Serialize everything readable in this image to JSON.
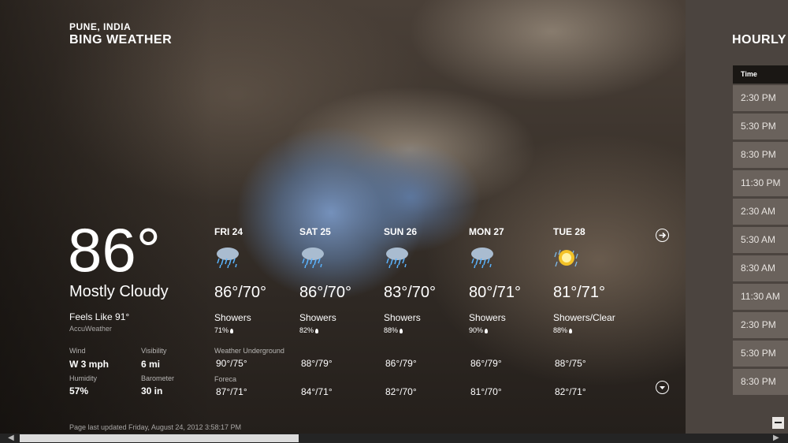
{
  "location": "PUNE, INDIA",
  "app_title": "BING WEATHER",
  "current": {
    "temp": "86°",
    "condition": "Mostly Cloudy",
    "feels_like": "Feels Like 91°",
    "provider": "AccuWeather",
    "stats": [
      {
        "label": "Wind",
        "value": "W 3 mph"
      },
      {
        "label": "Visibility",
        "value": "6 mi"
      },
      {
        "label": "Humidity",
        "value": "57%"
      },
      {
        "label": "Barometer",
        "value": "30 in"
      }
    ]
  },
  "sources": [
    "Weather Underground",
    "Foreca"
  ],
  "forecast": [
    {
      "day": "FRI 24",
      "icon": "showers-icon",
      "hilo": "86°/70°",
      "desc": "Showers",
      "precip": "71%",
      "src1": "90°/75°",
      "src2": "87°/71°"
    },
    {
      "day": "SAT 25",
      "icon": "showers-icon",
      "hilo": "86°/70°",
      "desc": "Showers",
      "precip": "82%",
      "src1": "88°/79°",
      "src2": "84°/71°"
    },
    {
      "day": "SUN 26",
      "icon": "showers-icon",
      "hilo": "83°/70°",
      "desc": "Showers",
      "precip": "88%",
      "src1": "86°/79°",
      "src2": "82°/70°"
    },
    {
      "day": "MON 27",
      "icon": "showers-icon",
      "hilo": "80°/71°",
      "desc": "Showers",
      "precip": "90%",
      "src1": "86°/79°",
      "src2": "81°/70°"
    },
    {
      "day": "TUE 28",
      "icon": "sun-showers-icon",
      "hilo": "81°/71°",
      "desc": "Showers/Clear",
      "precip": "88%",
      "src1": "88°/75°",
      "src2": "82°/71°"
    }
  ],
  "updated": "Page last updated Friday, August 24, 2012 3:58:17 PM",
  "hourly": {
    "title": "HOURLY",
    "header": "Time",
    "times": [
      "2:30 PM",
      "5:30 PM",
      "8:30 PM",
      "11:30 PM",
      "2:30 AM",
      "5:30 AM",
      "8:30 AM",
      "11:30 AM",
      "2:30 PM",
      "5:30 PM",
      "8:30 PM"
    ]
  },
  "colors": {
    "hourly_panel": "#4b443f",
    "time_cell": "#6a625c",
    "header": "#1a1714"
  }
}
